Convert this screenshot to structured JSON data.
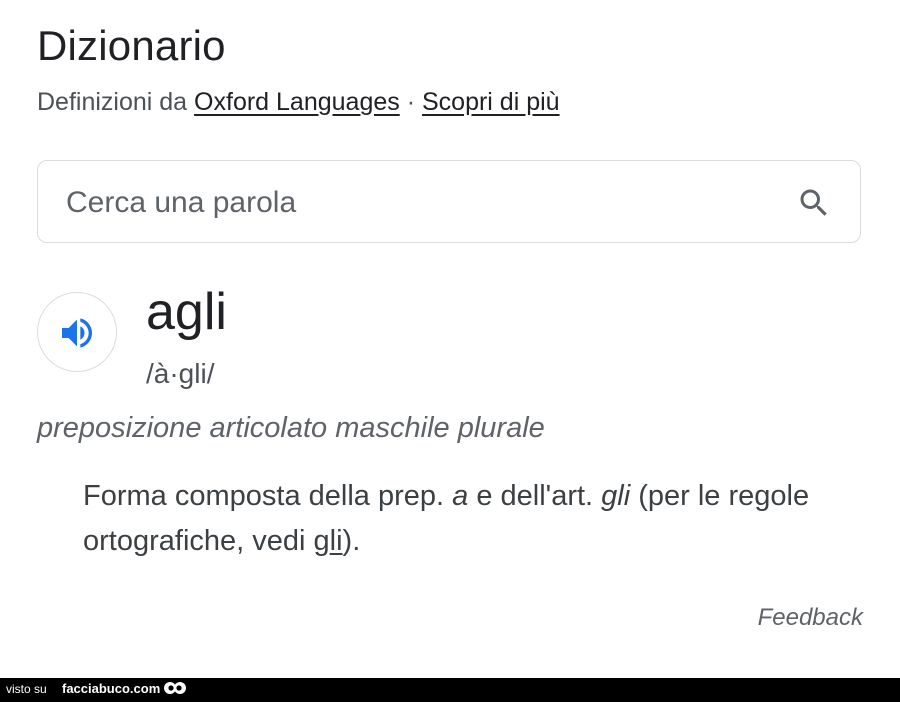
{
  "header": {
    "title": "Dizionario",
    "source_prefix": "Definizioni da",
    "source_link": "Oxford Languages",
    "separator": "·",
    "learn_more": "Scopri di più"
  },
  "search": {
    "placeholder": "Cerca una parola",
    "value": "",
    "icon": "search-icon"
  },
  "entry": {
    "audio_icon": "speaker-icon",
    "word": "agli",
    "phonetic": "/à·gli/",
    "part_of_speech": "preposizione articolato maschile plurale",
    "definition": {
      "part1": "Forma composta della prep. ",
      "term1": "a",
      "part2": " e dell'art. ",
      "term2": "gli",
      "part3": " (per le regole ortografiche, vedi ",
      "link_g": "g",
      "link_li": "li",
      "part4": ")."
    }
  },
  "footer": {
    "feedback": "Feedback"
  },
  "watermark": {
    "prefix": "visto su",
    "brand": "facciabuco.com"
  },
  "colors": {
    "accent_blue": "#1a73e8",
    "text_primary": "#202124",
    "text_secondary": "#5f6368",
    "border": "#dadce0"
  }
}
